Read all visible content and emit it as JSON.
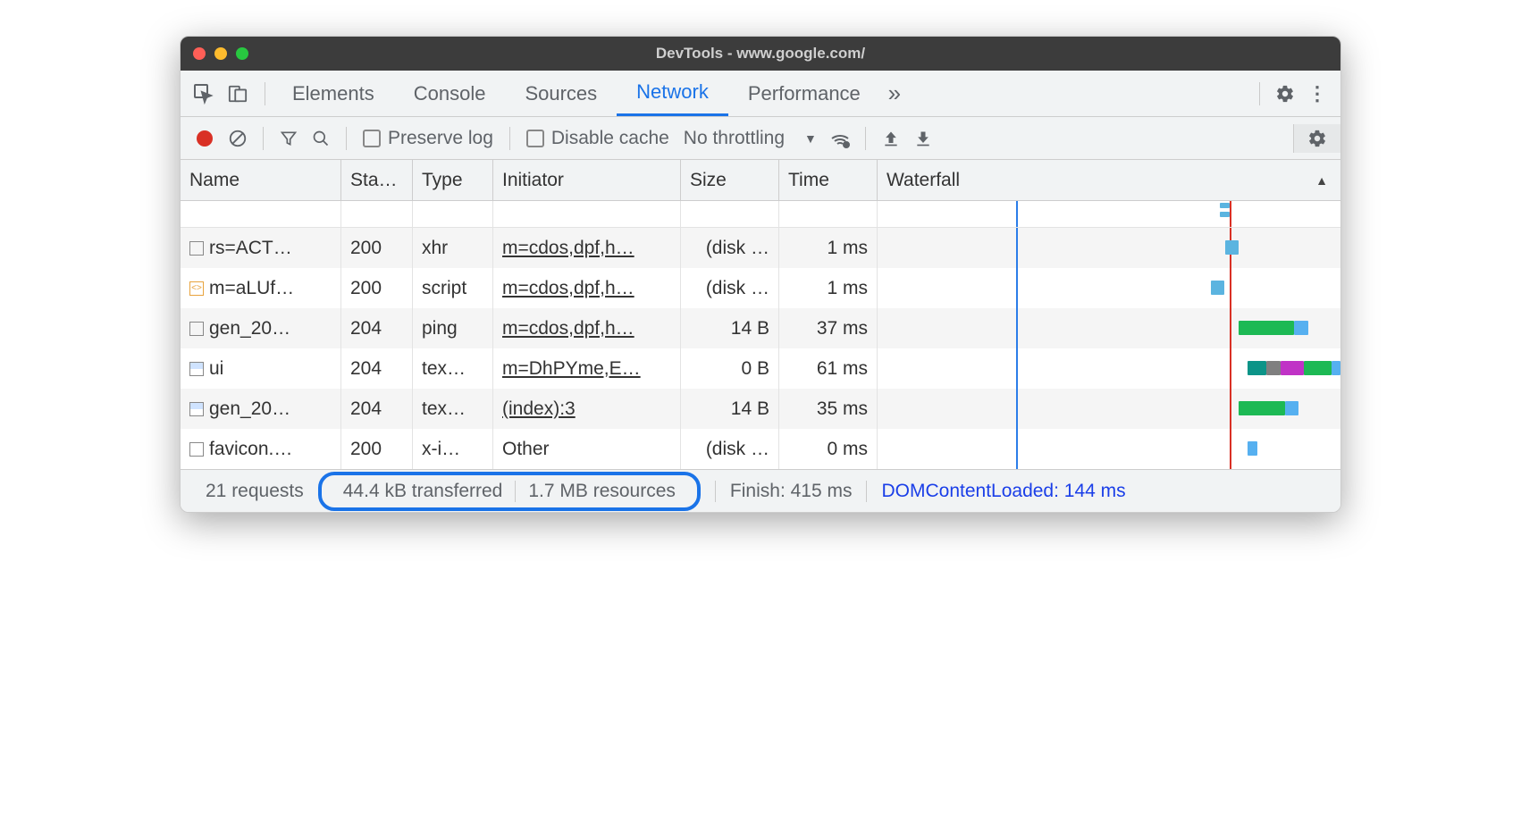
{
  "window": {
    "title": "DevTools - www.google.com/"
  },
  "tabs": {
    "items": [
      "Elements",
      "Console",
      "Sources",
      "Network",
      "Performance"
    ],
    "active": "Network"
  },
  "toolbar": {
    "preserve_log": "Preserve log",
    "disable_cache": "Disable cache",
    "throttling": "No throttling"
  },
  "columns": {
    "name": "Name",
    "status": "Sta…",
    "type": "Type",
    "initiator": "Initiator",
    "size": "Size",
    "time": "Time",
    "waterfall": "Waterfall"
  },
  "rows": [
    {
      "icon": "box",
      "name": "rs=ACT…",
      "status": "200",
      "type": "xhr",
      "initiator": "m=cdos,dpf,h…",
      "initiator_link": true,
      "size": "(disk …",
      "time": "1 ms",
      "wf": [
        {
          "l": 75,
          "w": 3,
          "c": "#5bb4e0"
        }
      ]
    },
    {
      "icon": "script",
      "name": "m=aLUf…",
      "status": "200",
      "type": "script",
      "initiator": "m=cdos,dpf,h…",
      "initiator_link": true,
      "size": "(disk …",
      "time": "1 ms",
      "wf": [
        {
          "l": 72,
          "w": 3,
          "c": "#5bb4e0"
        }
      ]
    },
    {
      "icon": "box",
      "name": "gen_20…",
      "status": "204",
      "type": "ping",
      "initiator": "m=cdos,dpf,h…",
      "initiator_link": true,
      "size": "14 B",
      "time": "37 ms",
      "wf": [
        {
          "l": 78,
          "w": 12,
          "c": "#1db954"
        },
        {
          "l": 90,
          "w": 3,
          "c": "#56b0f0"
        }
      ]
    },
    {
      "icon": "img",
      "name": "ui",
      "status": "204",
      "type": "tex…",
      "initiator": "m=DhPYme,E…",
      "initiator_link": true,
      "size": "0 B",
      "time": "61 ms",
      "wf": [
        {
          "l": 80,
          "w": 4,
          "c": "#0c9488"
        },
        {
          "l": 84,
          "w": 3,
          "c": "#7f7f7f"
        },
        {
          "l": 87,
          "w": 5,
          "c": "#c033c6"
        },
        {
          "l": 92,
          "w": 6,
          "c": "#1db954"
        },
        {
          "l": 98,
          "w": 2,
          "c": "#56b0f0"
        }
      ]
    },
    {
      "icon": "img",
      "name": "gen_20…",
      "status": "204",
      "type": "tex…",
      "initiator": "(index):3",
      "initiator_link": true,
      "size": "14 B",
      "time": "35 ms",
      "wf": [
        {
          "l": 78,
          "w": 10,
          "c": "#1db954"
        },
        {
          "l": 88,
          "w": 3,
          "c": "#56b0f0"
        }
      ]
    },
    {
      "icon": "box",
      "name": "favicon.…",
      "status": "200",
      "type": "x-i…",
      "initiator": "Other",
      "initiator_link": false,
      "size": "(disk …",
      "time": "0 ms",
      "wf": [
        {
          "l": 80,
          "w": 2,
          "c": "#56b0f0"
        }
      ]
    }
  ],
  "status": {
    "requests": "21 requests",
    "transferred": "44.4 kB transferred",
    "resources": "1.7 MB resources",
    "finish": "Finish: 415 ms",
    "dcl": "DOMContentLoaded: 144 ms"
  },
  "waterfall_lines": {
    "blue_pct": 30,
    "red_pct": 76
  }
}
